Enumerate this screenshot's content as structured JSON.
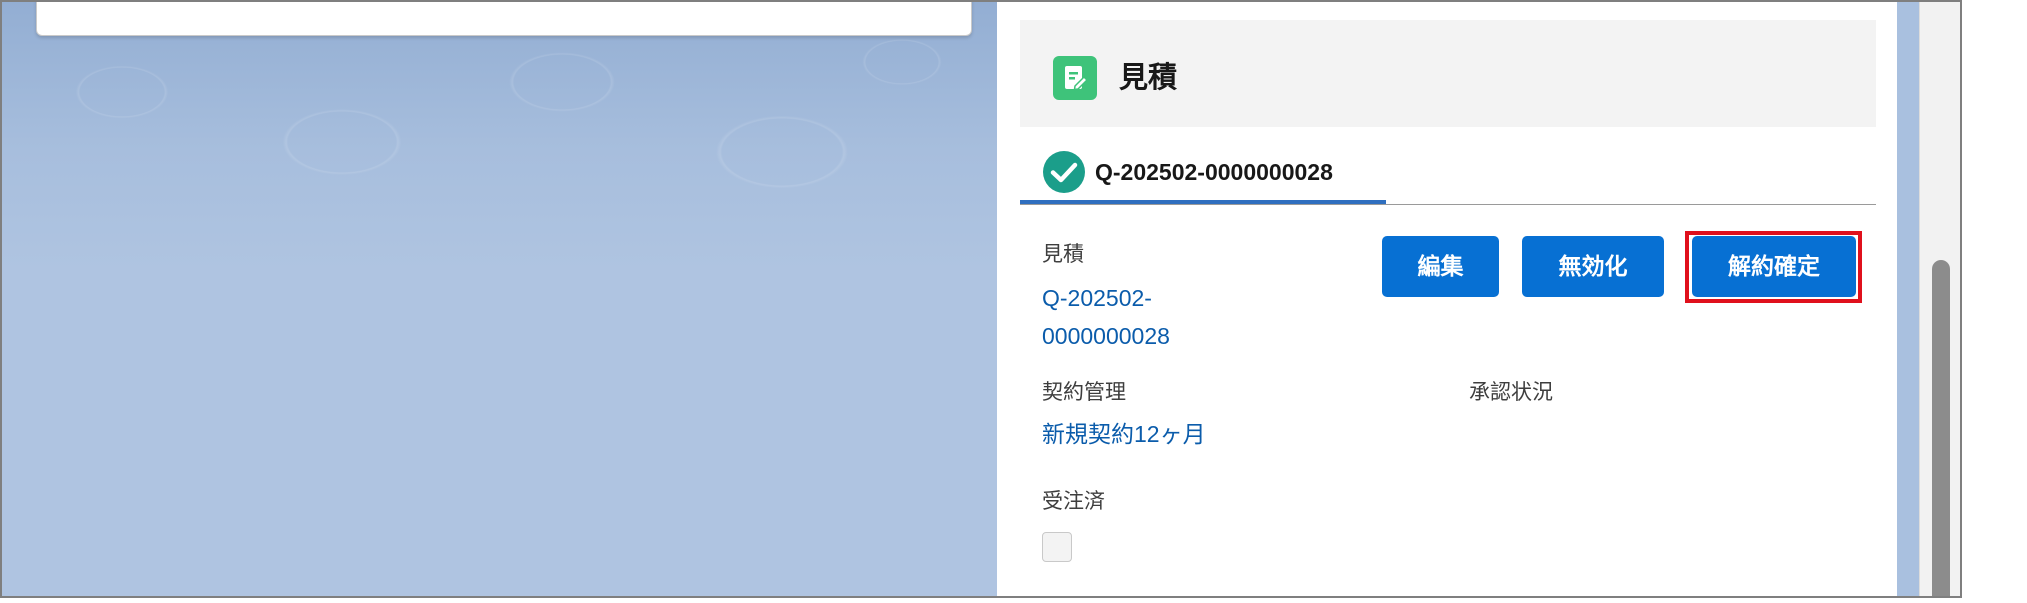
{
  "header": {
    "title": "見積",
    "icon": "quote-icon"
  },
  "tab": {
    "label": "Q-202502-0000000028",
    "icon": "check-circle-icon"
  },
  "fields": {
    "quote_label": "見積",
    "quote_value_line1": "Q-202502-",
    "quote_value_line2": "0000000028",
    "contract_label": "契約管理",
    "contract_value": "新規契約12ヶ月",
    "approval_label": "承認状況",
    "ordered_label": "受注済",
    "ordered_checked": false
  },
  "actions": {
    "edit": "編集",
    "disable": "無効化",
    "confirm_cancel": "解約確定"
  },
  "colors": {
    "brand_button": "#0770d3",
    "link": "#0b5cab",
    "highlight": "#e0101c",
    "icon_green": "#3ec37a",
    "check_teal": "#1b9e8a"
  }
}
